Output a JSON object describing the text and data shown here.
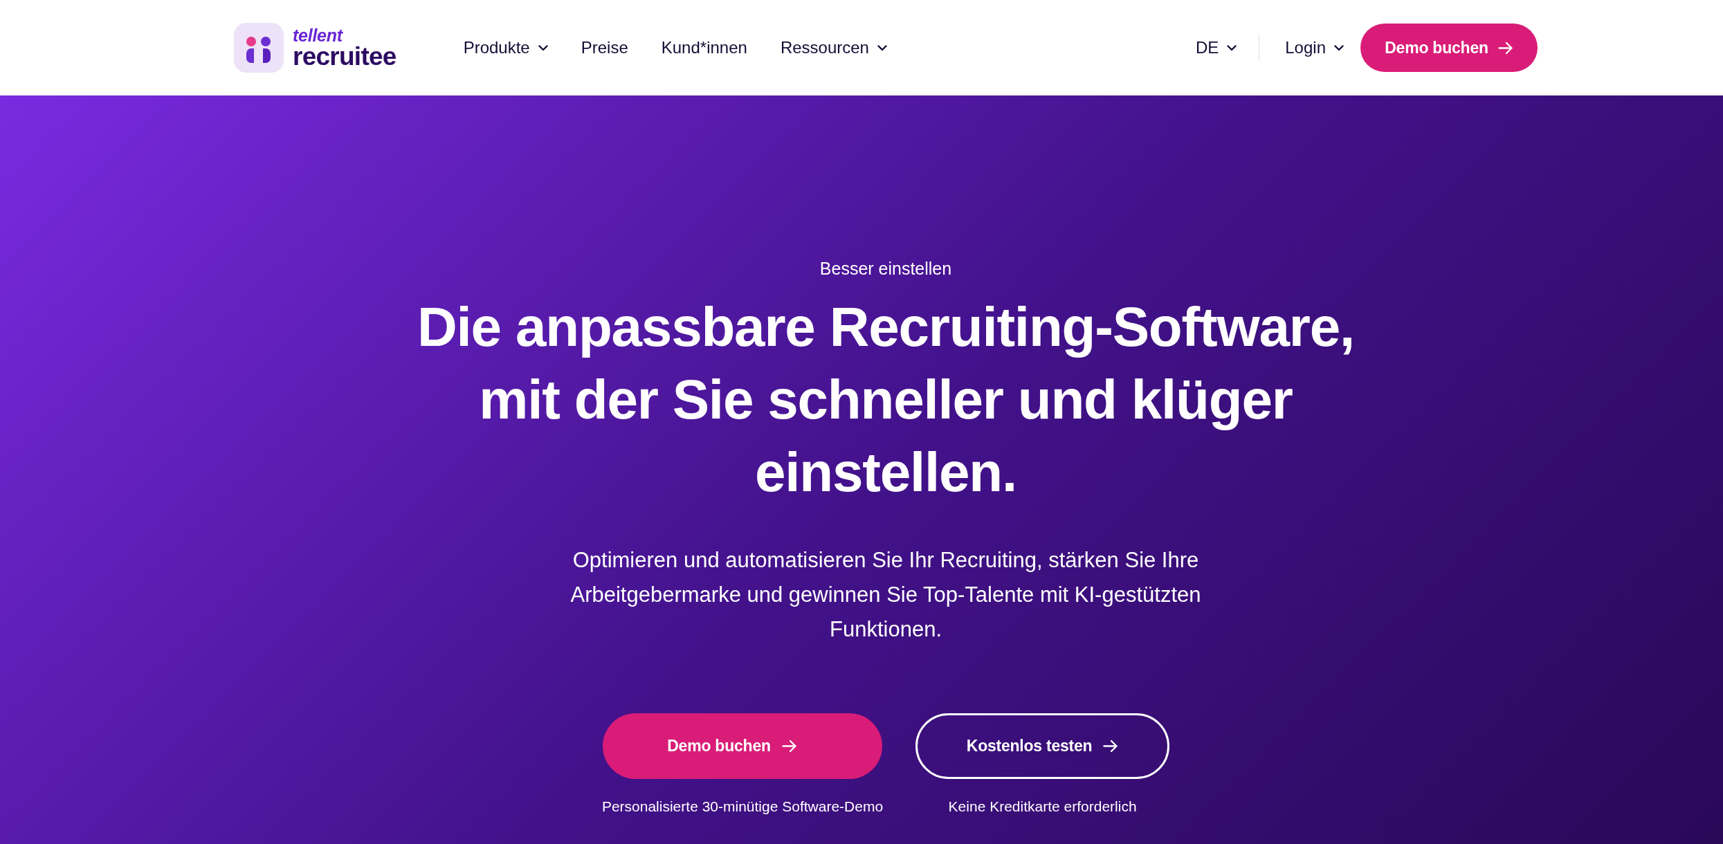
{
  "header": {
    "logo": {
      "brand": "tellent",
      "product": "recruitee"
    },
    "nav": [
      {
        "label": "Produkte",
        "dropdown": true
      },
      {
        "label": "Preise",
        "dropdown": false
      },
      {
        "label": "Kund*innen",
        "dropdown": false
      },
      {
        "label": "Ressourcen",
        "dropdown": true
      }
    ],
    "language": {
      "label": "DE",
      "dropdown": true
    },
    "login": {
      "label": "Login",
      "dropdown": true
    },
    "cta": {
      "label": "Demo buchen"
    }
  },
  "hero": {
    "eyebrow": "Besser einstellen",
    "headline": "Die anpassbare Recruiting-Software, mit der Sie schneller und klüger einstellen.",
    "subtitle": "Optimieren und automatisieren Sie Ihr Recruiting, stärken Sie Ihre Arbeitgebermarke und gewinnen Sie Top-Talente mit KI-gestützten Funktionen.",
    "actions": [
      {
        "kind": "primary",
        "label": "Demo buchen",
        "caption": "Personalisierte 30-minütige Software-Demo"
      },
      {
        "kind": "outline",
        "label": "Kostenlos testen",
        "caption": "Keine Kreditkarte erforderlich"
      }
    ]
  }
}
